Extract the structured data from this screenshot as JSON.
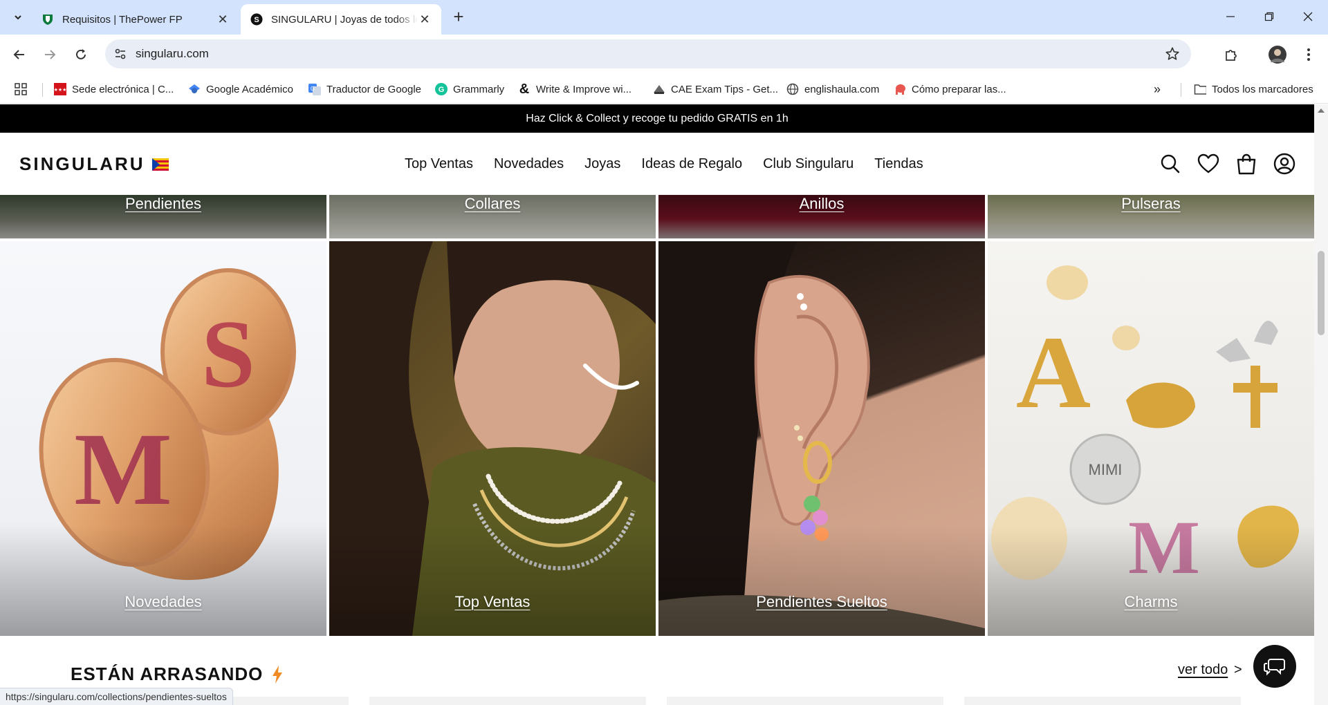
{
  "browser": {
    "tabs": [
      {
        "title": "Requisitos | ThePower FP",
        "active": false,
        "favicon": "shield-icon"
      },
      {
        "title": "SINGULARU | Joyas de todos los",
        "active": true,
        "favicon": "singularu-s-icon"
      }
    ],
    "address": "singularu.com",
    "bookmarks": [
      {
        "label": "Sede electrónica | C...",
        "icon": "madrid-icon"
      },
      {
        "label": "Google Académico",
        "icon": "scholar-icon"
      },
      {
        "label": "Traductor de Google",
        "icon": "translate-icon"
      },
      {
        "label": "Grammarly",
        "icon": "grammarly-icon"
      },
      {
        "label": "Write & Improve wi...",
        "icon": "ampersand-icon"
      },
      {
        "label": "CAE Exam Tips - Get...",
        "icon": "cae-icon"
      },
      {
        "label": "englishaula.com",
        "icon": "globe-icon"
      },
      {
        "label": "Cómo preparar las...",
        "icon": "elephant-icon"
      }
    ],
    "all_bookmarks": "Todos los marcadores",
    "status_url": "https://singularu.com/collections/pendientes-sueltos"
  },
  "site": {
    "announcement": "Haz Click & Collect y recoge tu pedido GRATIS en 1h",
    "logo": "SINGULARU",
    "nav": [
      "Top Ventas",
      "Novedades",
      "Joyas",
      "Ideas de Regalo",
      "Club Singularu",
      "Tiendas"
    ],
    "top_categories": [
      "Pendientes",
      "Collares",
      "Anillos",
      "Pulseras"
    ],
    "main_categories": [
      "Novedades",
      "Top Ventas",
      "Pendientes Sueltos",
      "Charms"
    ],
    "section_title": "ESTÁN ARRASANDO",
    "see_all": "ver todo",
    "see_all_arrow": ">"
  },
  "colors": {
    "chrome_tabstrip": "#d3e3fd",
    "announcement_bg": "#000000",
    "accent_bolt": "#f08a24"
  }
}
